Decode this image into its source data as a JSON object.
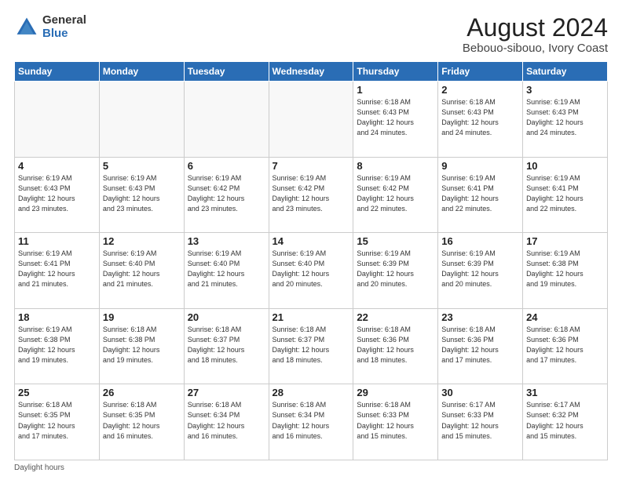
{
  "logo": {
    "general": "General",
    "blue": "Blue"
  },
  "title": "August 2024",
  "subtitle": "Bebouo-sibouo, Ivory Coast",
  "weekdays": [
    "Sunday",
    "Monday",
    "Tuesday",
    "Wednesday",
    "Thursday",
    "Friday",
    "Saturday"
  ],
  "footer": "Daylight hours",
  "weeks": [
    [
      {
        "day": "",
        "info": ""
      },
      {
        "day": "",
        "info": ""
      },
      {
        "day": "",
        "info": ""
      },
      {
        "day": "",
        "info": ""
      },
      {
        "day": "1",
        "info": "Sunrise: 6:18 AM\nSunset: 6:43 PM\nDaylight: 12 hours\nand 24 minutes."
      },
      {
        "day": "2",
        "info": "Sunrise: 6:18 AM\nSunset: 6:43 PM\nDaylight: 12 hours\nand 24 minutes."
      },
      {
        "day": "3",
        "info": "Sunrise: 6:19 AM\nSunset: 6:43 PM\nDaylight: 12 hours\nand 24 minutes."
      }
    ],
    [
      {
        "day": "4",
        "info": "Sunrise: 6:19 AM\nSunset: 6:43 PM\nDaylight: 12 hours\nand 23 minutes."
      },
      {
        "day": "5",
        "info": "Sunrise: 6:19 AM\nSunset: 6:43 PM\nDaylight: 12 hours\nand 23 minutes."
      },
      {
        "day": "6",
        "info": "Sunrise: 6:19 AM\nSunset: 6:42 PM\nDaylight: 12 hours\nand 23 minutes."
      },
      {
        "day": "7",
        "info": "Sunrise: 6:19 AM\nSunset: 6:42 PM\nDaylight: 12 hours\nand 23 minutes."
      },
      {
        "day": "8",
        "info": "Sunrise: 6:19 AM\nSunset: 6:42 PM\nDaylight: 12 hours\nand 22 minutes."
      },
      {
        "day": "9",
        "info": "Sunrise: 6:19 AM\nSunset: 6:41 PM\nDaylight: 12 hours\nand 22 minutes."
      },
      {
        "day": "10",
        "info": "Sunrise: 6:19 AM\nSunset: 6:41 PM\nDaylight: 12 hours\nand 22 minutes."
      }
    ],
    [
      {
        "day": "11",
        "info": "Sunrise: 6:19 AM\nSunset: 6:41 PM\nDaylight: 12 hours\nand 21 minutes."
      },
      {
        "day": "12",
        "info": "Sunrise: 6:19 AM\nSunset: 6:40 PM\nDaylight: 12 hours\nand 21 minutes."
      },
      {
        "day": "13",
        "info": "Sunrise: 6:19 AM\nSunset: 6:40 PM\nDaylight: 12 hours\nand 21 minutes."
      },
      {
        "day": "14",
        "info": "Sunrise: 6:19 AM\nSunset: 6:40 PM\nDaylight: 12 hours\nand 20 minutes."
      },
      {
        "day": "15",
        "info": "Sunrise: 6:19 AM\nSunset: 6:39 PM\nDaylight: 12 hours\nand 20 minutes."
      },
      {
        "day": "16",
        "info": "Sunrise: 6:19 AM\nSunset: 6:39 PM\nDaylight: 12 hours\nand 20 minutes."
      },
      {
        "day": "17",
        "info": "Sunrise: 6:19 AM\nSunset: 6:38 PM\nDaylight: 12 hours\nand 19 minutes."
      }
    ],
    [
      {
        "day": "18",
        "info": "Sunrise: 6:19 AM\nSunset: 6:38 PM\nDaylight: 12 hours\nand 19 minutes."
      },
      {
        "day": "19",
        "info": "Sunrise: 6:18 AM\nSunset: 6:38 PM\nDaylight: 12 hours\nand 19 minutes."
      },
      {
        "day": "20",
        "info": "Sunrise: 6:18 AM\nSunset: 6:37 PM\nDaylight: 12 hours\nand 18 minutes."
      },
      {
        "day": "21",
        "info": "Sunrise: 6:18 AM\nSunset: 6:37 PM\nDaylight: 12 hours\nand 18 minutes."
      },
      {
        "day": "22",
        "info": "Sunrise: 6:18 AM\nSunset: 6:36 PM\nDaylight: 12 hours\nand 18 minutes."
      },
      {
        "day": "23",
        "info": "Sunrise: 6:18 AM\nSunset: 6:36 PM\nDaylight: 12 hours\nand 17 minutes."
      },
      {
        "day": "24",
        "info": "Sunrise: 6:18 AM\nSunset: 6:36 PM\nDaylight: 12 hours\nand 17 minutes."
      }
    ],
    [
      {
        "day": "25",
        "info": "Sunrise: 6:18 AM\nSunset: 6:35 PM\nDaylight: 12 hours\nand 17 minutes."
      },
      {
        "day": "26",
        "info": "Sunrise: 6:18 AM\nSunset: 6:35 PM\nDaylight: 12 hours\nand 16 minutes."
      },
      {
        "day": "27",
        "info": "Sunrise: 6:18 AM\nSunset: 6:34 PM\nDaylight: 12 hours\nand 16 minutes."
      },
      {
        "day": "28",
        "info": "Sunrise: 6:18 AM\nSunset: 6:34 PM\nDaylight: 12 hours\nand 16 minutes."
      },
      {
        "day": "29",
        "info": "Sunrise: 6:18 AM\nSunset: 6:33 PM\nDaylight: 12 hours\nand 15 minutes."
      },
      {
        "day": "30",
        "info": "Sunrise: 6:17 AM\nSunset: 6:33 PM\nDaylight: 12 hours\nand 15 minutes."
      },
      {
        "day": "31",
        "info": "Sunrise: 6:17 AM\nSunset: 6:32 PM\nDaylight: 12 hours\nand 15 minutes."
      }
    ]
  ]
}
